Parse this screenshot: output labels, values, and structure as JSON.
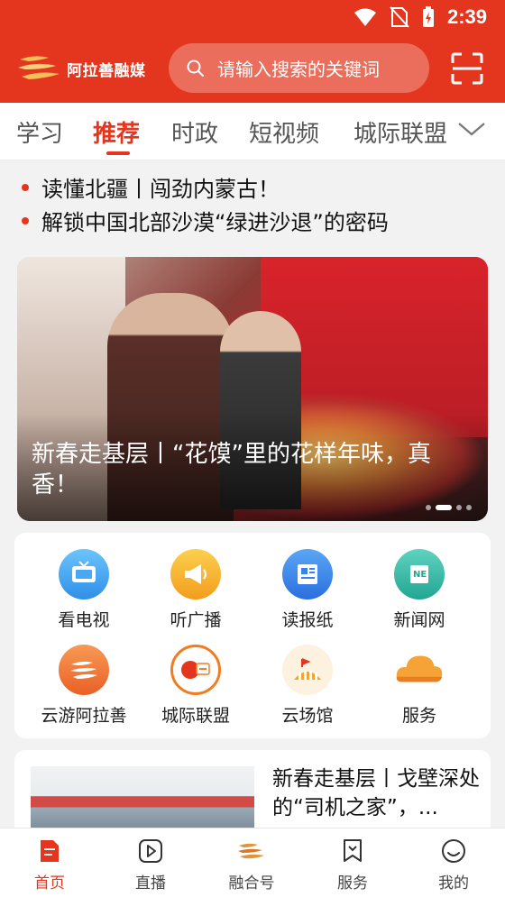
{
  "status": {
    "time": "2:39"
  },
  "header": {
    "logo_text": "阿拉善融媒",
    "search_placeholder": "请输入搜索的关键词"
  },
  "tabs": [
    {
      "label": "学习"
    },
    {
      "label": "推荐"
    },
    {
      "label": "时政"
    },
    {
      "label": "短视频"
    },
    {
      "label": "城际联盟"
    }
  ],
  "headlines": [
    {
      "text": "读懂北疆丨闯劲内蒙古！"
    },
    {
      "text": "解锁中国北部沙漠“绿进沙退”的密码"
    }
  ],
  "banner": {
    "title": "新春走基层丨“花馍”里的花样年味，真香！",
    "page_count": 4,
    "current_page": 2
  },
  "services": [
    {
      "label": "看电视",
      "icon": "tv-icon",
      "color": "#3fa6f2"
    },
    {
      "label": "听广播",
      "icon": "megaphone-icon",
      "color": "#f7b22c"
    },
    {
      "label": "读报纸",
      "icon": "newspaper-icon",
      "color": "#3b82e8"
    },
    {
      "label": "新闻网",
      "icon": "news-web-icon",
      "color": "#2fb9a6"
    },
    {
      "label": "云游阿拉善",
      "icon": "alashan-tour-icon",
      "color": "#f0773a"
    },
    {
      "label": "城际联盟",
      "icon": "city-alliance-icon",
      "color": "#ef7d22"
    },
    {
      "label": "云场馆",
      "icon": "venue-icon",
      "color": "#f2a531"
    },
    {
      "label": "服务",
      "icon": "cloud-icon",
      "color": "#f39a2c"
    }
  ],
  "news": {
    "title": "新春走基层丨戈壁深处的“司机之家”，..."
  },
  "bottom_nav": [
    {
      "label": "首页",
      "active": true
    },
    {
      "label": "直播"
    },
    {
      "label": "融合号"
    },
    {
      "label": "服务"
    },
    {
      "label": "我的"
    }
  ],
  "colors": {
    "brand": "#e4361f"
  }
}
